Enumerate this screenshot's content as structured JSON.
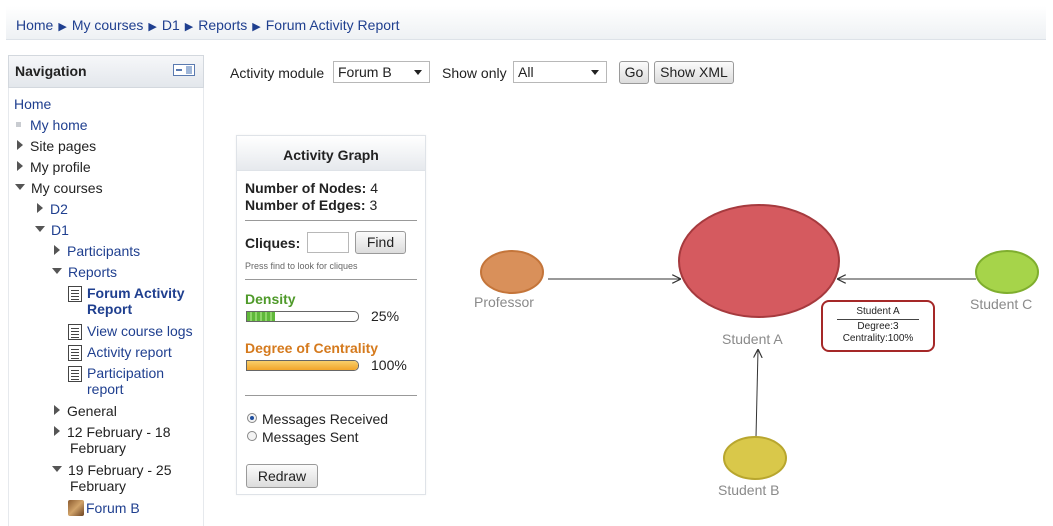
{
  "breadcrumb": [
    "Home",
    "My courses",
    "D1",
    "Reports",
    "Forum Activity Report"
  ],
  "navigation": {
    "title": "Navigation",
    "home": "Home",
    "my_home": "My home",
    "site_pages": "Site pages",
    "my_profile": "My profile",
    "my_courses": "My courses",
    "d2": "D2",
    "d1": "D1",
    "participants": "Participants",
    "reports": "Reports",
    "forum_activity_report_1": "Forum Activity",
    "forum_activity_report_2": "Report",
    "view_course_logs": "View course logs",
    "activity_report": "Activity report",
    "participation_report_1": "Participation",
    "participation_report_2": "report",
    "general": "General",
    "week1_1": "12 February - 18",
    "week1_2": "February",
    "week2_1": "19 February - 25",
    "week2_2": "February",
    "forum_b": "Forum B"
  },
  "toolbar": {
    "activity_module_label": "Activity module",
    "activity_module_value": "Forum B",
    "show_only_label": "Show only",
    "show_only_value": "All",
    "go_label": "Go",
    "show_xml_label": "Show XML"
  },
  "panel": {
    "title": "Activity Graph",
    "nodes_label": "Number of Nodes:",
    "nodes_value": "4",
    "edges_label": "Number of Edges:",
    "edges_value": "3",
    "cliques_label": "Cliques:",
    "find_label": "Find",
    "cliques_hint": "Press find to look for cliques",
    "density_label": "Density",
    "density_value": "25%",
    "density_fraction": 0.25,
    "centrality_label": "Degree of Centrality",
    "centrality_value": "100%",
    "centrality_fraction": 1.0,
    "messages_received": "Messages Received",
    "messages_sent": "Messages Sent",
    "redraw_label": "Redraw",
    "colors": {
      "density": "#5fb83a",
      "centrality": "#f2a52a",
      "centrality_label": "#d57a1d",
      "density_label": "#4f9a2a"
    }
  },
  "graph": {
    "nodes": [
      {
        "name": "Professor",
        "color": "#d9905a"
      },
      {
        "name": "Student A",
        "color": "#d55a5f"
      },
      {
        "name": "Student C",
        "color": "#a6d44a"
      },
      {
        "name": "Student B",
        "color": "#d9c84a"
      }
    ],
    "edges": [
      {
        "from": "Professor",
        "to": "Student A"
      },
      {
        "from": "Student C",
        "to": "Student A"
      },
      {
        "from": "Student B",
        "to": "Student A"
      }
    ],
    "tooltip": {
      "name": "Student A",
      "degree": "Degree:3",
      "centrality": "Centrality:100%"
    }
  }
}
